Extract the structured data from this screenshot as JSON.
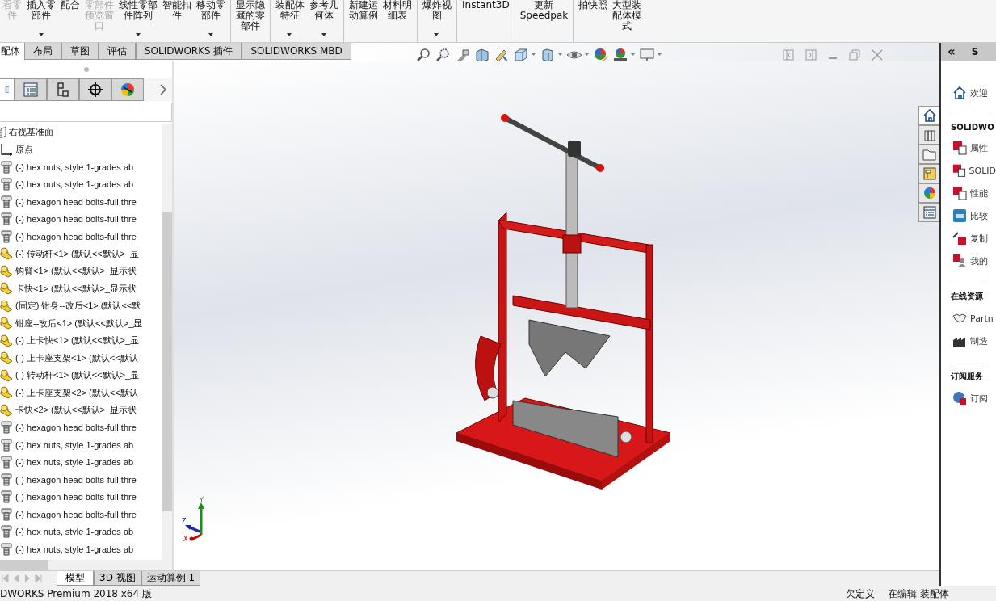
{
  "ribbon": {
    "buttons": [
      {
        "lines": [
          "看零",
          "件"
        ],
        "disabled": true,
        "dropdown": false,
        "separator_before": false
      },
      {
        "lines": [
          "插入零",
          "部件"
        ],
        "disabled": false,
        "dropdown": true,
        "separator_before": false
      },
      {
        "lines": [
          "配合"
        ],
        "disabled": false,
        "dropdown": false,
        "separator_before": false
      },
      {
        "lines": [
          "零部件",
          "预览窗",
          "口"
        ],
        "disabled": true,
        "dropdown": false,
        "separator_before": false
      },
      {
        "lines": [
          "线性零部",
          "件阵列"
        ],
        "disabled": false,
        "dropdown": true,
        "separator_before": false
      },
      {
        "lines": [
          "智能扣",
          "件"
        ],
        "disabled": false,
        "dropdown": false,
        "separator_before": false
      },
      {
        "lines": [
          "移动零",
          "部件"
        ],
        "disabled": false,
        "dropdown": true,
        "separator_before": false
      },
      {
        "lines": [
          "显示隐",
          "藏的零",
          "部件"
        ],
        "disabled": false,
        "dropdown": false,
        "separator_before": true
      },
      {
        "lines": [
          "装配体",
          "特征"
        ],
        "disabled": false,
        "dropdown": true,
        "separator_before": true
      },
      {
        "lines": [
          "参考几",
          "何体"
        ],
        "disabled": false,
        "dropdown": true,
        "separator_before": false
      },
      {
        "lines": [
          "新建运",
          "动算例"
        ],
        "disabled": false,
        "dropdown": false,
        "separator_before": true
      },
      {
        "lines": [
          "材料明",
          "细表"
        ],
        "disabled": false,
        "dropdown": false,
        "separator_before": false
      },
      {
        "lines": [
          "爆炸视",
          "图"
        ],
        "disabled": false,
        "dropdown": true,
        "separator_before": true
      },
      {
        "lines": [
          "Instant3D"
        ],
        "disabled": false,
        "dropdown": false,
        "separator_before": true
      },
      {
        "lines": [
          "更新",
          "Speedpak"
        ],
        "disabled": false,
        "dropdown": false,
        "separator_before": true
      },
      {
        "lines": [
          "拍快照"
        ],
        "disabled": false,
        "dropdown": false,
        "separator_before": true
      },
      {
        "lines": [
          "大型装",
          "配体模",
          "式"
        ],
        "disabled": false,
        "dropdown": false,
        "separator_before": false
      }
    ]
  },
  "command_tabs": [
    {
      "label": "配体",
      "selected": true
    },
    {
      "label": "布局",
      "selected": false
    },
    {
      "label": "草图",
      "selected": false
    },
    {
      "label": "评估",
      "selected": false
    },
    {
      "label": "SOLIDWORKS 插件",
      "selected": false
    },
    {
      "label": "SOLIDWORKS MBD",
      "selected": false
    }
  ],
  "panel_tabs": [
    {
      "kind": "feature-tree",
      "selected": true
    },
    {
      "kind": "property",
      "selected": false
    },
    {
      "kind": "configuration",
      "selected": false
    },
    {
      "kind": "dimxpert",
      "selected": false
    },
    {
      "kind": "display",
      "selected": false
    }
  ],
  "tree": [
    {
      "kind": "plane",
      "label": "右视基准面"
    },
    {
      "kind": "origin",
      "label": "原点"
    },
    {
      "kind": "fastener",
      "label": "(-) hex nuts, style 1-grades ab"
    },
    {
      "kind": "fastener",
      "label": "(-) hex nuts, style 1-grades ab"
    },
    {
      "kind": "fastener",
      "label": "(-) hexagon head bolts-full thre"
    },
    {
      "kind": "fastener",
      "label": "(-) hexagon head bolts-full thre"
    },
    {
      "kind": "fastener",
      "label": "(-) hexagon head bolts-full thre"
    },
    {
      "kind": "part",
      "label": "(-) 传动杆<1> (默认<<默认>_显"
    },
    {
      "kind": "part",
      "label": "钩臂<1> (默认<<默认>_显示状"
    },
    {
      "kind": "part",
      "label": "卡快<1> (默认<<默认>_显示状"
    },
    {
      "kind": "part",
      "label": "(固定) 钳身--改后<1> (默认<<默"
    },
    {
      "kind": "part",
      "label": "钳座--改后<1> (默认<<默认>_显"
    },
    {
      "kind": "part",
      "label": "(-) 上卡快<1> (默认<<默认>_显"
    },
    {
      "kind": "part",
      "label": "(-) 上卡座支架<1> (默认<<默认"
    },
    {
      "kind": "part",
      "label": "(-) 转动杆<1> (默认<<默认>_显"
    },
    {
      "kind": "part",
      "label": "(-) 上卡座支架<2> (默认<<默认"
    },
    {
      "kind": "part",
      "label": "卡快<2> (默认<<默认>_显示状"
    },
    {
      "kind": "fastener",
      "label": "(-) hexagon head bolts-full thre"
    },
    {
      "kind": "fastener",
      "label": "(-) hex nuts, style 1-grades ab"
    },
    {
      "kind": "fastener",
      "label": "(-) hex nuts, style 1-grades ab"
    },
    {
      "kind": "fastener",
      "label": "(-) hexagon head bolts-full thre"
    },
    {
      "kind": "fastener",
      "label": "(-) hexagon head bolts-full thre"
    },
    {
      "kind": "fastener",
      "label": "(-) hexagon head bolts-full thre"
    },
    {
      "kind": "fastener",
      "label": "(-) hex nuts, style 1-grades ab"
    },
    {
      "kind": "fastener",
      "label": "(-) hex nuts, style 1-grades ab"
    }
  ],
  "bottom_tabs": [
    {
      "label": "模型",
      "selected": true
    },
    {
      "label": "3D 视图",
      "selected": false
    },
    {
      "label": "运动算例 1",
      "selected": false
    }
  ],
  "triad": {
    "x": "X",
    "y": "Y",
    "z": "Z"
  },
  "task_pane": {
    "collapse": "«",
    "title": "S",
    "tabs": [
      {
        "kind": "home",
        "selected": true
      },
      {
        "kind": "library",
        "selected": false
      },
      {
        "kind": "folder",
        "selected": false
      },
      {
        "kind": "palette",
        "selected": false
      },
      {
        "kind": "appearance",
        "selected": false
      },
      {
        "kind": "properties",
        "selected": false
      }
    ],
    "items": [
      {
        "kind": "home",
        "label": "欢迎"
      },
      {
        "kind": "heading",
        "label": "SOLIDWO"
      },
      {
        "kind": "document",
        "label": "属性"
      },
      {
        "kind": "document",
        "label": "SOLID"
      },
      {
        "kind": "document",
        "label": "性能"
      },
      {
        "kind": "compare",
        "label": "比较"
      },
      {
        "kind": "copy",
        "label": "复制"
      },
      {
        "kind": "user",
        "label": "我的"
      },
      {
        "kind": "heading",
        "label": "在线资源"
      },
      {
        "kind": "handshake",
        "label": "Partn"
      },
      {
        "kind": "factory",
        "label": "制造"
      },
      {
        "kind": "heading",
        "label": "订阅服务"
      },
      {
        "kind": "globe",
        "label": "订阅"
      }
    ]
  },
  "status_bar": {
    "product": "DWORKS Premium 2018 x64 版",
    "state": "欠定义",
    "mode": "在编辑 装配体"
  }
}
